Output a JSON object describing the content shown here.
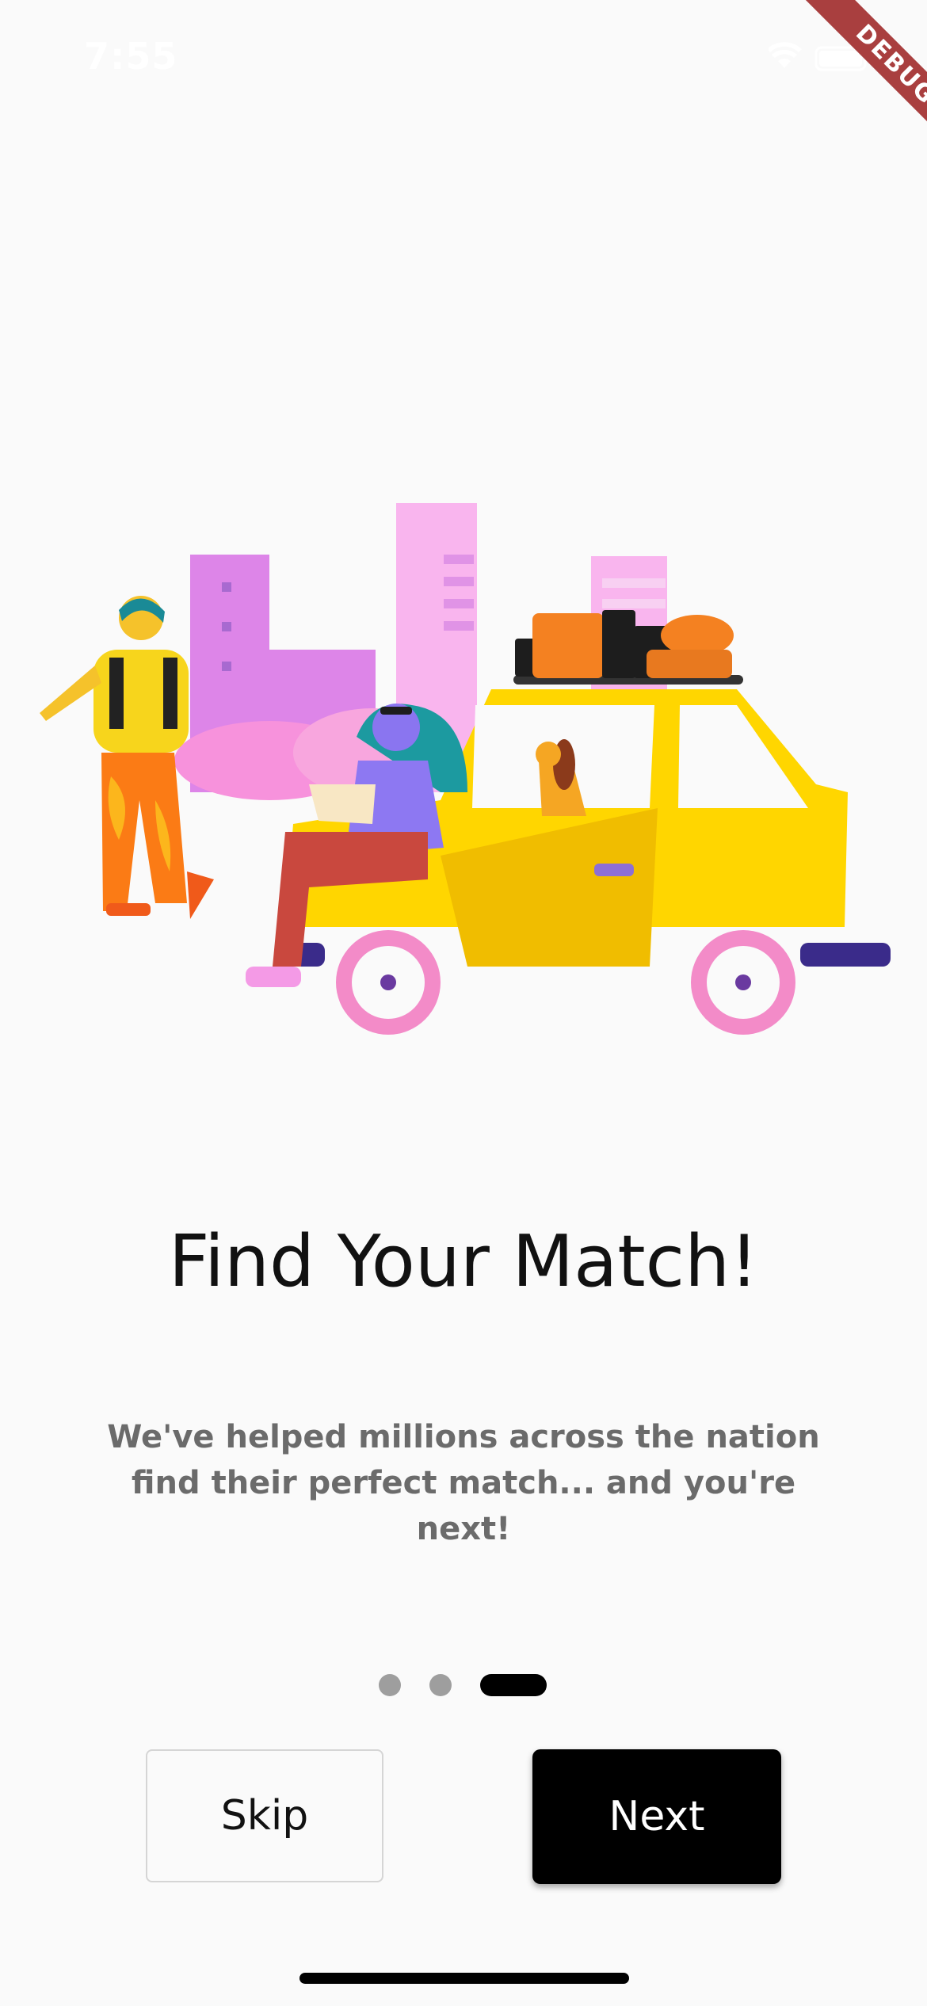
{
  "status_bar": {
    "time": "7:55",
    "wifi_icon": "wifi-icon",
    "battery_icon": "battery-icon"
  },
  "debug_banner": {
    "label": "DEBUG",
    "color": "#a93f3f"
  },
  "onboarding": {
    "illustration": "travel-car-illustration",
    "title": "Find Your Match!",
    "subtitle": "We've helped millions across the nation find their perfect match... and you're next!",
    "page_indicator": {
      "total": 3,
      "current": 3
    }
  },
  "actions": {
    "skip_label": "Skip",
    "next_label": "Next"
  },
  "colors": {
    "background": "#fafafa",
    "primary": "#000000",
    "subtitle": "#6b6b6b",
    "indicator_inactive": "#9e9e9e"
  }
}
